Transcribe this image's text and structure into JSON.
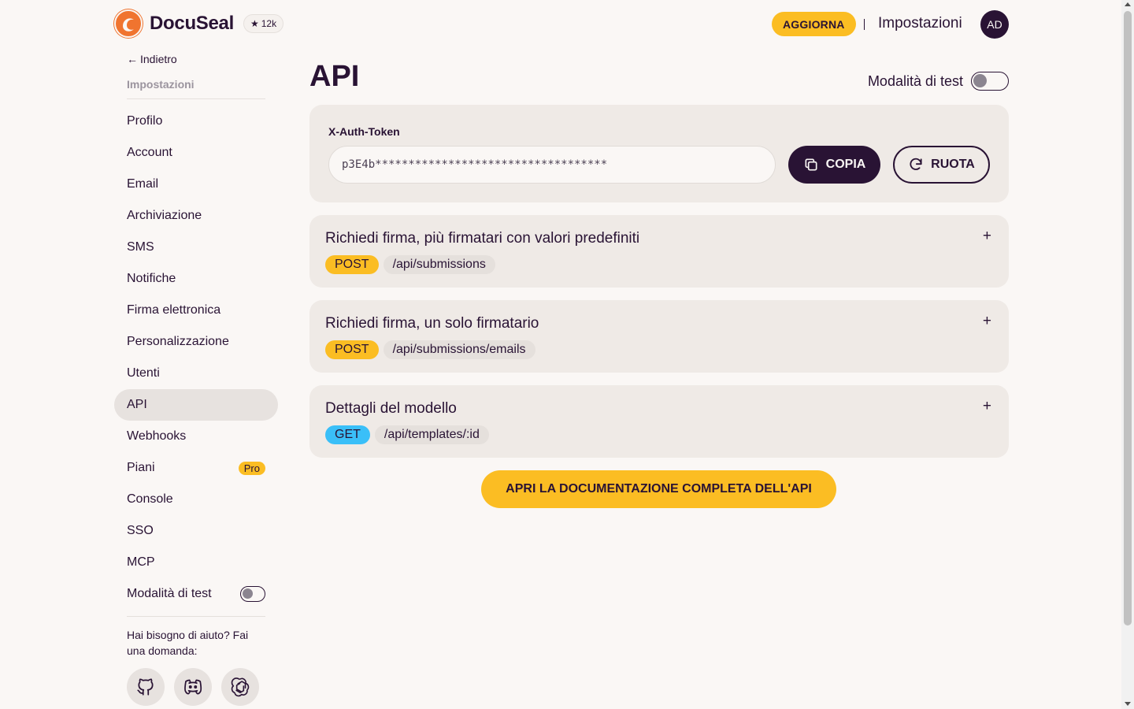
{
  "header": {
    "brand": "DocuSeal",
    "stars": "12k",
    "upgrade_label": "AGGIORNA",
    "settings_label": "Impostazioni",
    "avatar_initials": "AD"
  },
  "sidebar": {
    "back_label": "Indietro",
    "heading": "Impostazioni",
    "items": [
      {
        "label": "Profilo"
      },
      {
        "label": "Account"
      },
      {
        "label": "Email"
      },
      {
        "label": "Archiviazione"
      },
      {
        "label": "SMS"
      },
      {
        "label": "Notifiche"
      },
      {
        "label": "Firma elettronica"
      },
      {
        "label": "Personalizzazione"
      },
      {
        "label": "Utenti"
      },
      {
        "label": "API",
        "active": true
      },
      {
        "label": "Webhooks"
      },
      {
        "label": "Piani",
        "badge": "Pro"
      },
      {
        "label": "Console"
      },
      {
        "label": "SSO"
      },
      {
        "label": "MCP"
      },
      {
        "label": "Modalità di test",
        "toggle": false
      }
    ],
    "help_text": "Hai bisogno di aiuto? Fai una domanda:",
    "help_icons": [
      "github-icon",
      "discord-icon",
      "openai-icon"
    ]
  },
  "main": {
    "title": "API",
    "test_mode_label": "Modalità di test",
    "test_mode_on": false,
    "token_label": "X-Auth-Token",
    "token_value": "p3E4b***********************************",
    "copy_label": "COPIA",
    "rotate_label": "RUOTA",
    "endpoints": [
      {
        "title": "Richiedi firma, più firmatari con valori predefiniti",
        "method": "POST",
        "path": "/api/submissions"
      },
      {
        "title": "Richiedi firma, un solo firmatario",
        "method": "POST",
        "path": "/api/submissions/emails"
      },
      {
        "title": "Dettagli del modello",
        "method": "GET",
        "path": "/api/templates/:id"
      }
    ],
    "docs_label": "APRI LA DOCUMENTAZIONE COMPLETA DELL'API",
    "plus_symbol": "+"
  },
  "colors": {
    "background": "#faf7f5",
    "primary": "#291334",
    "warning": "#fbbd23",
    "info": "#3abff8",
    "card": "#efeae6"
  }
}
